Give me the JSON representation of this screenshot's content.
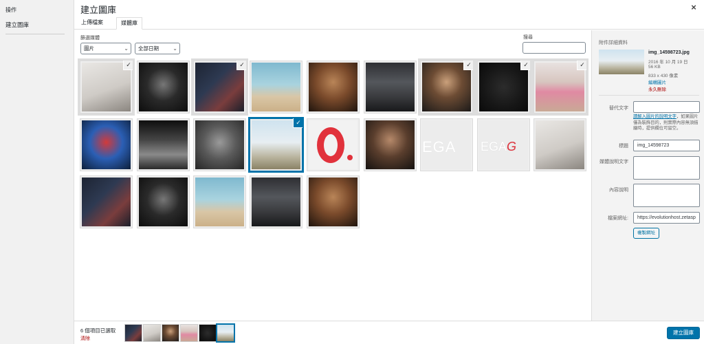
{
  "left_menu": {
    "title": "操作",
    "item": "建立圖庫"
  },
  "modal": {
    "title": "建立圖庫",
    "close_symbol": "×"
  },
  "tabs": [
    {
      "label": "上傳檔案"
    },
    {
      "label": "媒體庫"
    }
  ],
  "filters": {
    "label": "篩選媒體",
    "type_value": "圖片",
    "date_value": "全部日期",
    "search_label": "搜尋"
  },
  "grid": {
    "rows": [
      [
        "1",
        "2",
        "3",
        "4",
        "5",
        "6",
        "7",
        "8",
        "9"
      ],
      [
        "10",
        "11",
        "12",
        "13",
        "14",
        "15",
        "16",
        "17",
        "18"
      ],
      [
        "19",
        "20",
        "21",
        "22",
        "23"
      ]
    ],
    "selected_ids": [
      "1",
      "3",
      "7",
      "8",
      "9",
      "13"
    ],
    "focused_id": "13",
    "check_symbol": "✓"
  },
  "details": {
    "heading": "附件詳細資料",
    "filename": "img_14598723.jpg",
    "date": "2016 年 10 月 19 日",
    "size": "56 KB",
    "dimensions": "833 x 430 像素",
    "edit_link": "編輯圖片",
    "delete_link": "永久刪除",
    "alt_label": "替代文字",
    "alt_help_link": "讀解入圖片的說明文字",
    "alt_help_text": "，如果圖片僅為裝飾目的，則實際內容無須描繪時，提供欄位可留空。",
    "title_label": "標題",
    "title_value": "img_14598723",
    "caption_label": "媒體說明文字",
    "description_label": "內容說明",
    "url_label": "檔案網址:",
    "url_value": "https://evolutionhost.zetasp",
    "copy_button": "複製網址"
  },
  "footer": {
    "count": "6 個項目已選取",
    "clear": "清除",
    "create_button": "建立圖庫"
  },
  "colors": {
    "accent": "#0073aa",
    "danger": "#a00000",
    "brand_red": "#e1323c"
  }
}
